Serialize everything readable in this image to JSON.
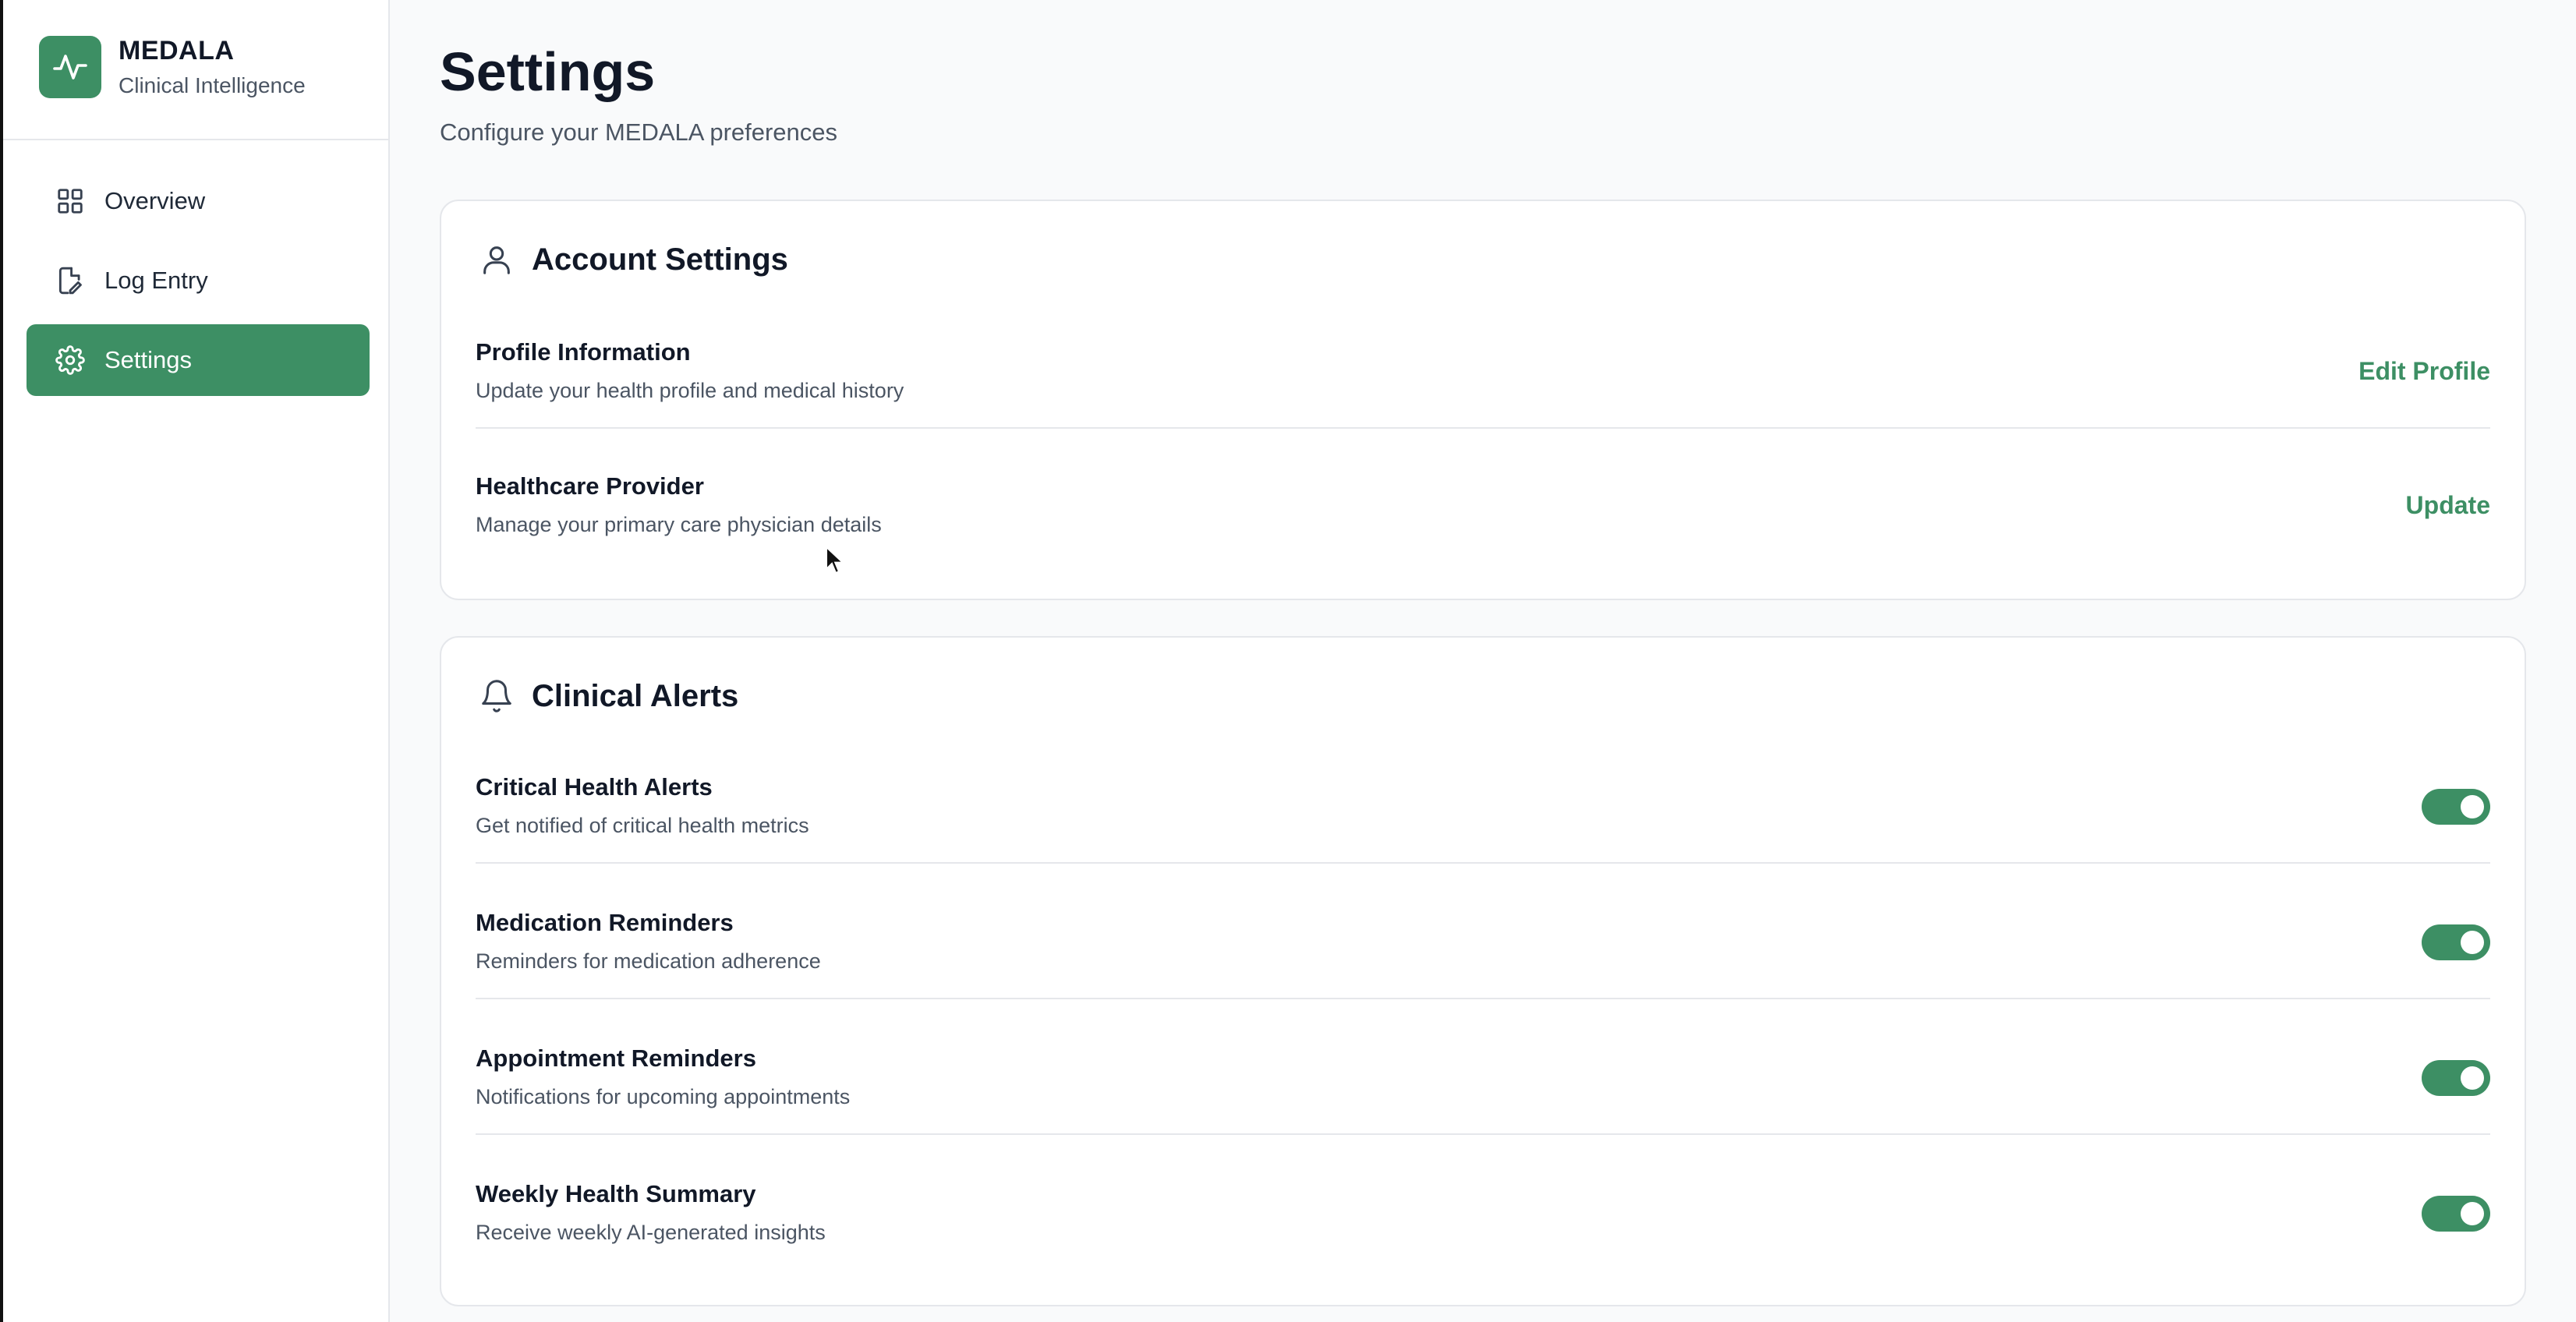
{
  "brand": {
    "name": "MEDALA",
    "subtitle": "Clinical Intelligence",
    "logo_icon": "activity-pulse-icon",
    "accent_color": "#3d8f64"
  },
  "sidebar": {
    "items": [
      {
        "label": "Overview",
        "icon": "grid-icon",
        "active": false
      },
      {
        "label": "Log Entry",
        "icon": "file-edit-icon",
        "active": false
      },
      {
        "label": "Settings",
        "icon": "gear-icon",
        "active": true
      }
    ]
  },
  "page": {
    "title": "Settings",
    "subtitle": "Configure your MEDALA preferences"
  },
  "account_settings": {
    "title": "Account Settings",
    "icon": "user-icon",
    "rows": [
      {
        "title": "Profile Information",
        "description": "Update your health profile and medical history",
        "action_label": "Edit Profile"
      },
      {
        "title": "Healthcare Provider",
        "description": "Manage your primary care physician details",
        "action_label": "Update"
      }
    ]
  },
  "clinical_alerts": {
    "title": "Clinical Alerts",
    "icon": "bell-icon",
    "rows": [
      {
        "title": "Critical Health Alerts",
        "description": "Get notified of critical health metrics",
        "enabled": true
      },
      {
        "title": "Medication Reminders",
        "description": "Reminders for medication adherence",
        "enabled": true
      },
      {
        "title": "Appointment Reminders",
        "description": "Notifications for upcoming appointments",
        "enabled": true
      },
      {
        "title": "Weekly Health Summary",
        "description": "Receive weekly AI-generated insights",
        "enabled": true
      }
    ]
  }
}
